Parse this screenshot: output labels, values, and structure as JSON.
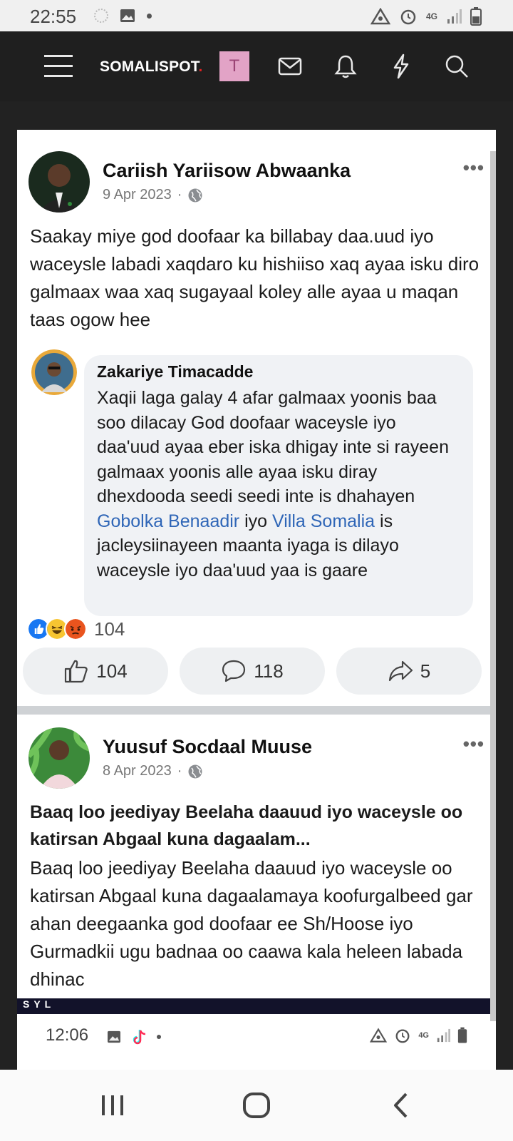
{
  "status_bar": {
    "time": "22:55",
    "network": "4G"
  },
  "app_header": {
    "brand": "SOMALISPOT",
    "brand_dot": ".",
    "avatar_letter": "T"
  },
  "post1": {
    "author": "Cariish Yariisow Abwaanka",
    "date": "9 Apr 2023",
    "separator": "·",
    "text": "Saakay miye god doofaar ka billabay daa.uud iyo waceysle labadi xaqdaro ku hishiiso  xaq ayaa isku diro galmaax waa xaq sugayaal koley alle ayaa u maqan taas ogow hee",
    "comment": {
      "author": "Zakariye Timacadde",
      "text_part1": "Xaqii laga galay 4 afar galmaax yoonis baa soo dilacay God doofaar waceysle iyo daa'uud ayaa eber iska dhigay inte si rayeen galmaax yoonis alle ayaa isku diray dhexdooda seedi seedi inte is dhahayen ",
      "link1": "Gobolka Benaadir",
      "text_part2": " iyo ",
      "link2": "Villa Somalia",
      "text_part3": " is jacleysiinayeen maanta iyaga is dilayo waceysle iyo daa'uud yaa is gaare"
    },
    "reaction_count": "104",
    "actions": {
      "likes": "104",
      "comments": "118",
      "shares": "5"
    }
  },
  "post2": {
    "author": "Yuusuf Socdaal Muuse",
    "date": "8 Apr 2023",
    "separator": "·",
    "headline": "Baaq loo jeediyay Beelaha daauud iyo waceysle oo katirsan Abgaal kuna dagaalam...",
    "text": "Baaq loo jeediyay Beelaha daauud iyo waceysle oo katirsan Abgaal kuna dagaalamaya koofurgalbeed gar ahan deegaanka god doofaar ee Sh/Hoose iyo Gurmadkii ugu badnaa oo caawa kala heleen labada dhinac"
  },
  "video_bar_text": "SYL",
  "inner_status_bar": {
    "time": "12:06",
    "network": "4G"
  },
  "colors": {
    "link": "#2f66b7",
    "header_bg": "#1f1f1f",
    "brand_dot": "#e02222",
    "avatar_bg": "#e2a3c6"
  }
}
